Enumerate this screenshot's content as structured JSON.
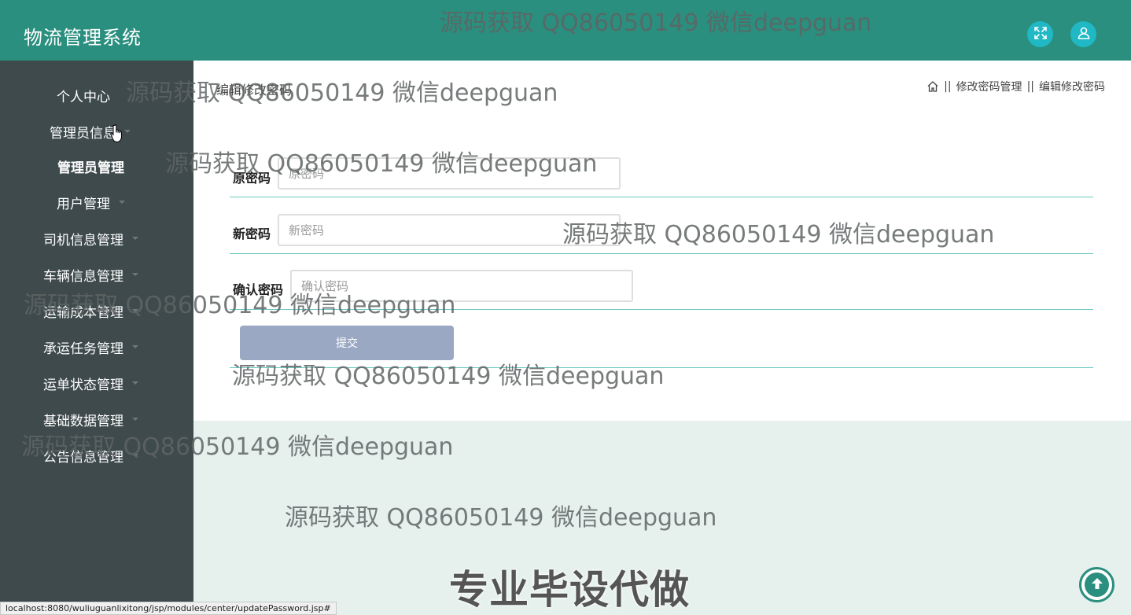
{
  "app": {
    "title": "物流管理系统"
  },
  "header": {
    "buttons": [
      {
        "icon": "fullscreen-icon"
      },
      {
        "icon": "user-icon"
      }
    ]
  },
  "sidebar": {
    "items": [
      {
        "label": "个人中心",
        "caret": false,
        "bold": false
      },
      {
        "label": "管理员信息",
        "caret": true,
        "bold": false
      },
      {
        "label": "管理员管理",
        "caret": false,
        "bold": true
      },
      {
        "label": "用户管理",
        "caret": true,
        "bold": false
      },
      {
        "label": "司机信息管理",
        "caret": true,
        "bold": false
      },
      {
        "label": "车辆信息管理",
        "caret": true,
        "bold": false
      },
      {
        "label": "运输成本管理",
        "caret": true,
        "bold": false
      },
      {
        "label": "承运任务管理",
        "caret": true,
        "bold": false
      },
      {
        "label": "运单状态管理",
        "caret": true,
        "bold": false
      },
      {
        "label": "基础数据管理",
        "caret": true,
        "bold": false
      },
      {
        "label": "公告信息管理",
        "caret": true,
        "bold": false
      }
    ]
  },
  "main": {
    "heading": "编辑修改密码",
    "breadcrumb": {
      "sep": "||",
      "section": "修改密码管理",
      "current": "编辑修改密码"
    },
    "form": {
      "fields": [
        {
          "label": "原密码",
          "placeholder": "原密码",
          "value": ""
        },
        {
          "label": "新密码",
          "placeholder": "新密码",
          "value": ""
        },
        {
          "label": "确认密码",
          "placeholder": "确认密码",
          "value": ""
        }
      ],
      "submit_label": "提交"
    }
  },
  "overlay": {
    "watermark_text": "源码获取 QQ86050149 微信deepguan",
    "banner_text": "专业毕设代做"
  },
  "statusbar": {
    "url": "localhost:8080/wuliuguanlixitong/jsp/modules/center/updatePassword.jsp#"
  },
  "colors": {
    "header": "#2a8f7e",
    "sidebar": "#3e4a4c",
    "accent_button": "#1fb8c4",
    "submit": "#9aa8c4",
    "divider": "#6cc9c1"
  }
}
